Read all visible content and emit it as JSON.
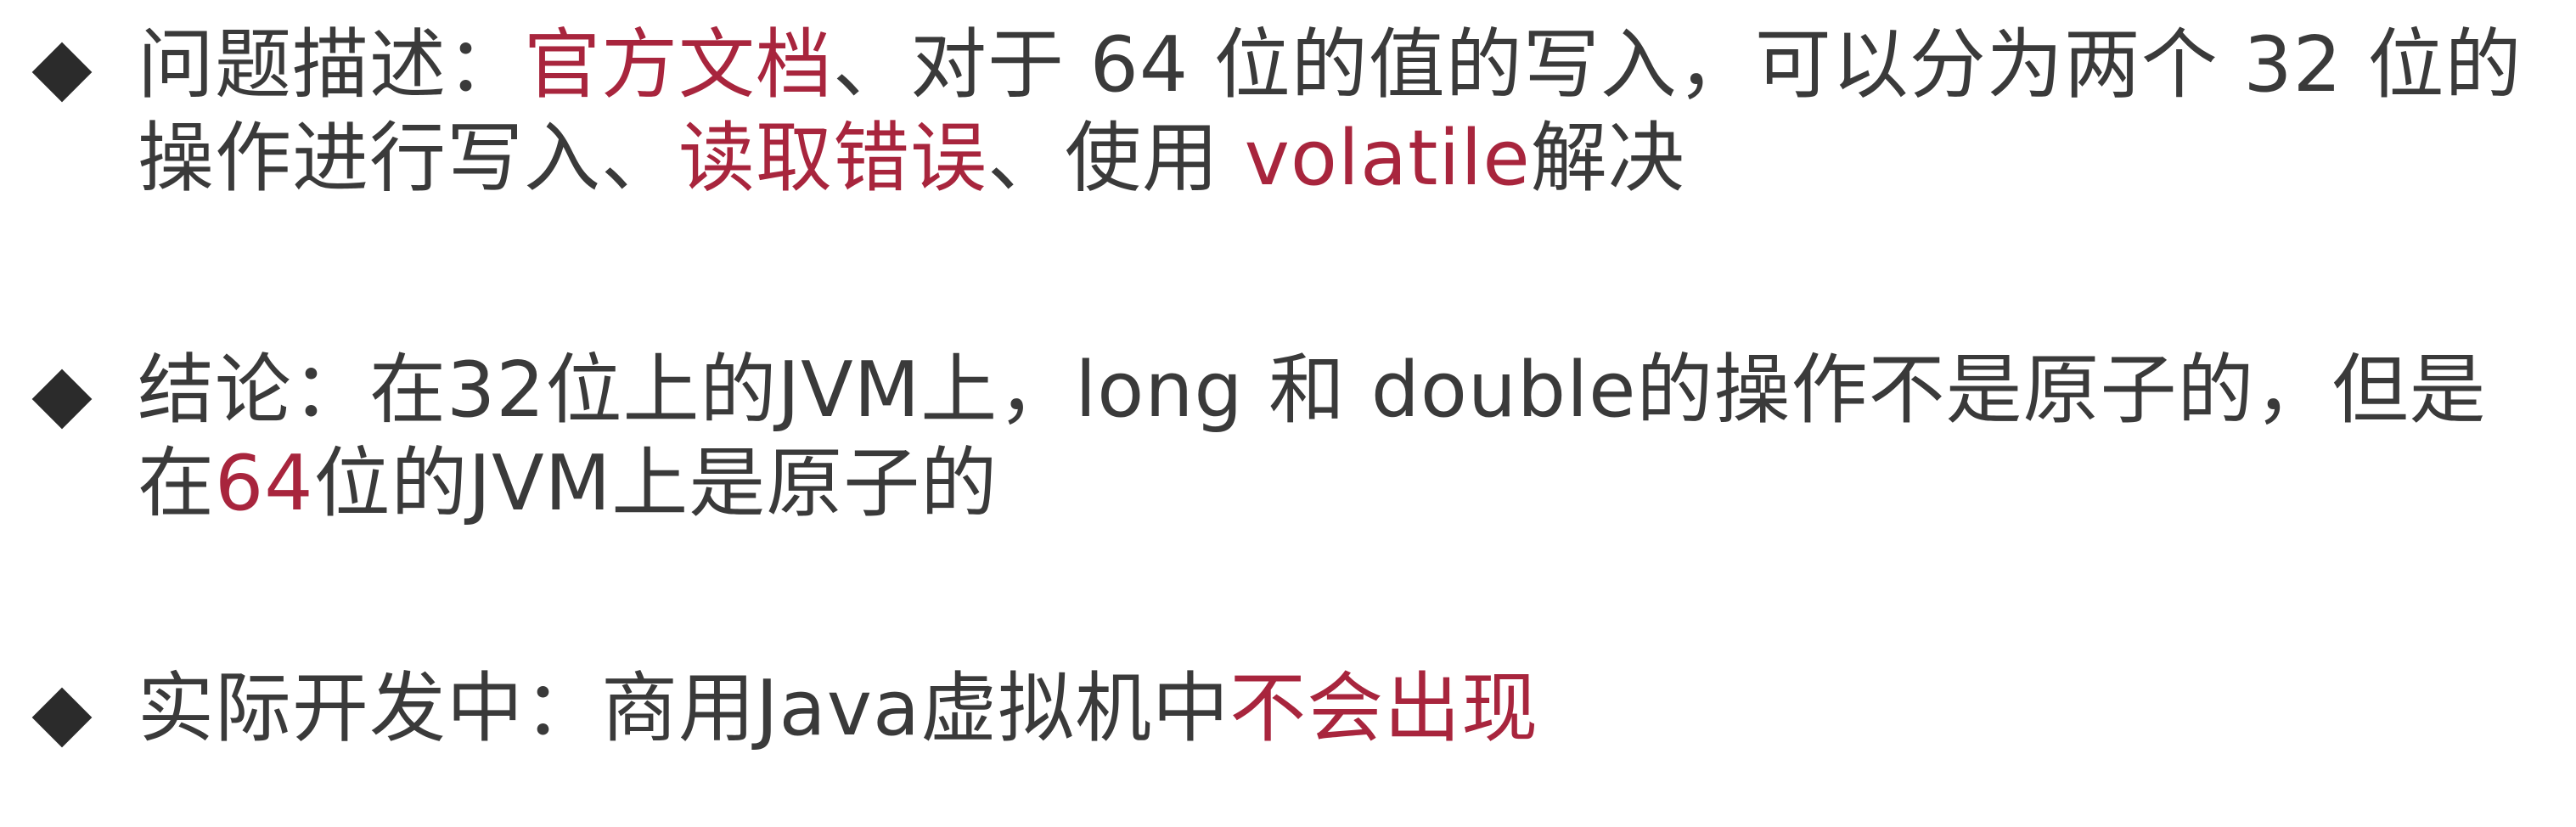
{
  "bullets": [
    {
      "icon": "diamond-bullet-icon",
      "lines": [
        [
          {
            "text": "问题描述：",
            "red": false
          },
          {
            "text": "官方文档",
            "red": true
          },
          {
            "text": "、对于 64 位的值的写入，可以分为两个 32 位的",
            "red": false
          }
        ],
        [
          {
            "text": "操作进行写入、",
            "red": false
          },
          {
            "text": "读取错误",
            "red": true
          },
          {
            "text": "、使用 ",
            "red": false
          },
          {
            "text": "volatile",
            "red": true
          },
          {
            "text": "解决",
            "red": false
          }
        ]
      ]
    },
    {
      "icon": "diamond-bullet-icon",
      "lines": [
        [
          {
            "text": "结论：在32位上的JVM上，long 和 double的操作不是原子的，但是",
            "red": false
          }
        ],
        [
          {
            "text": "在",
            "red": false
          },
          {
            "text": "64",
            "red": true
          },
          {
            "text": "位的JVM上是原子的",
            "red": false
          }
        ]
      ]
    },
    {
      "icon": "diamond-bullet-icon",
      "lines": [
        [
          {
            "text": "实际开发中：商用Java虚拟机中",
            "red": false
          },
          {
            "text": "不会出现",
            "red": true
          }
        ]
      ]
    }
  ],
  "colors": {
    "text": "#3a3a3a",
    "highlight": "#a8253d",
    "bullet": "#2b2b2b",
    "background": "#ffffff"
  }
}
